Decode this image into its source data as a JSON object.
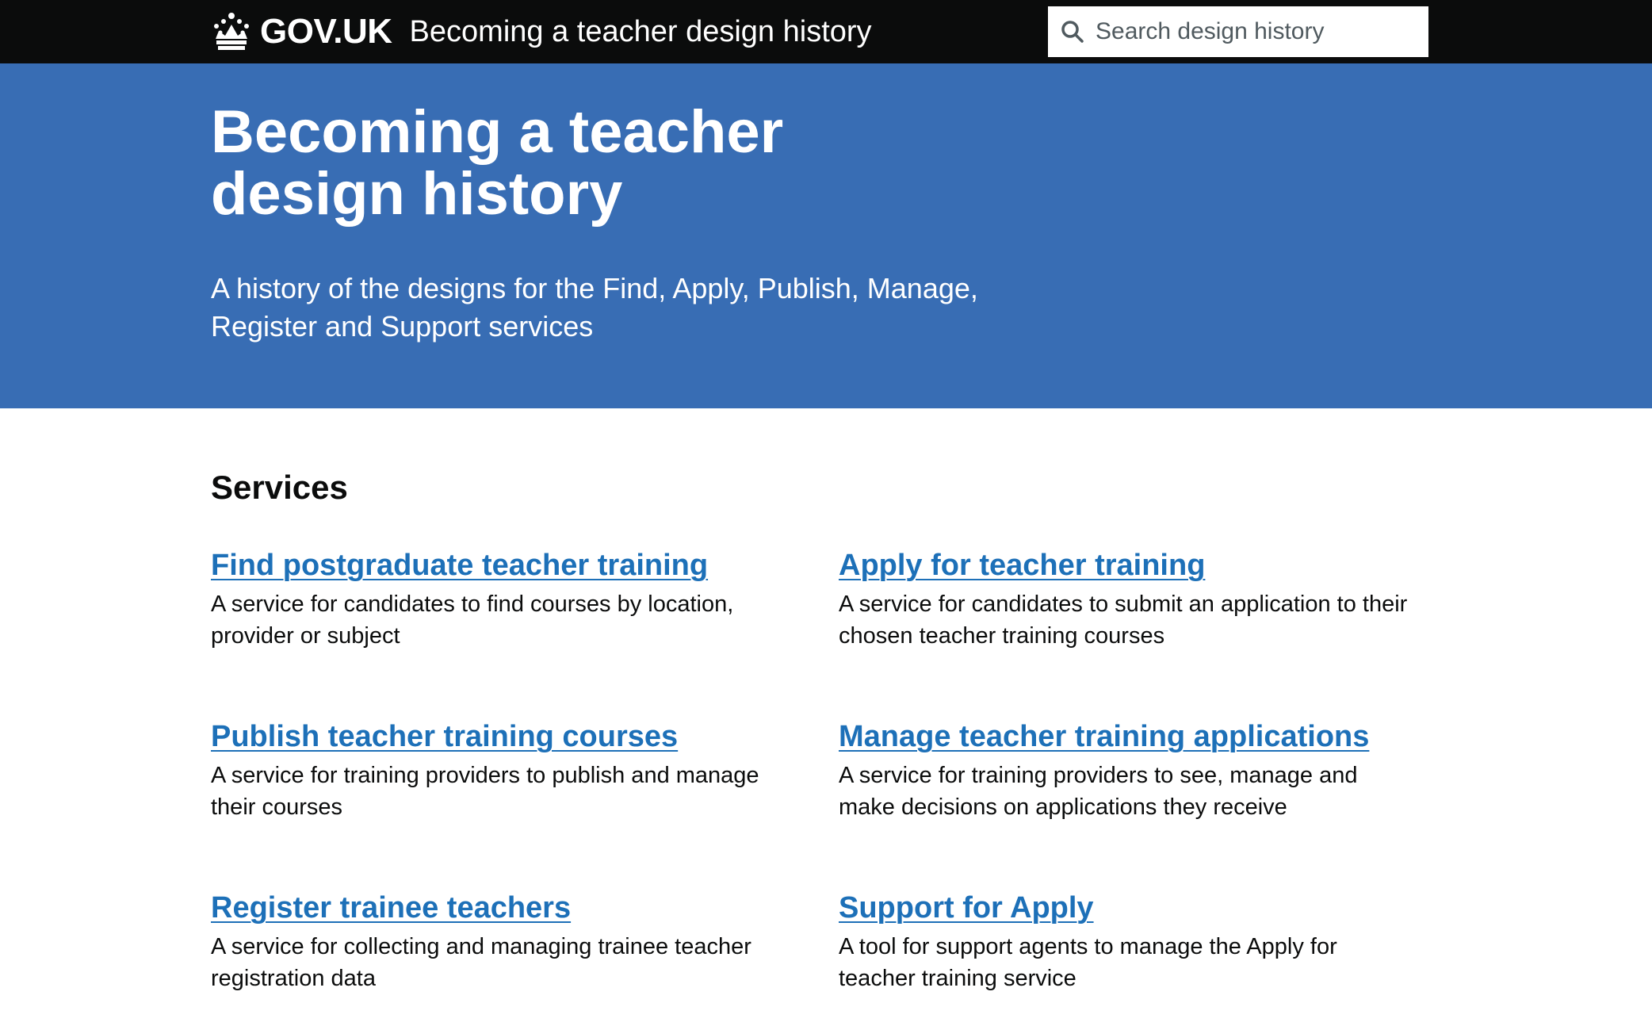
{
  "header": {
    "logo_text": "GOV.UK",
    "service_name": "Becoming a teacher design history",
    "search_placeholder": "Search design history"
  },
  "hero": {
    "title_line1": "Becoming a teacher",
    "title_line2": "design history",
    "description": "A history of the designs for the Find, Apply, Publish, Manage, Register and Support services"
  },
  "services": {
    "heading": "Services",
    "items": [
      {
        "title": "Find postgraduate teacher training",
        "description": "A service for candidates to find courses by location, provider or subject"
      },
      {
        "title": "Apply for teacher training",
        "description": "A service for candidates to submit an application to their chosen teacher training courses"
      },
      {
        "title": "Publish teacher training courses",
        "description": "A service for training providers to publish and manage their courses"
      },
      {
        "title": "Manage teacher training applications",
        "description": "A service for training providers to see, manage and make decisions on applications they receive"
      },
      {
        "title": "Register trainee teachers",
        "description": "A service for collecting and managing trainee teacher registration data"
      },
      {
        "title": "Support for Apply",
        "description": "A tool for support agents to manage the Apply for teacher training service"
      }
    ]
  },
  "colors": {
    "header_bg": "#0b0c0c",
    "hero_bg": "#386db4",
    "link": "#1d70b8"
  }
}
